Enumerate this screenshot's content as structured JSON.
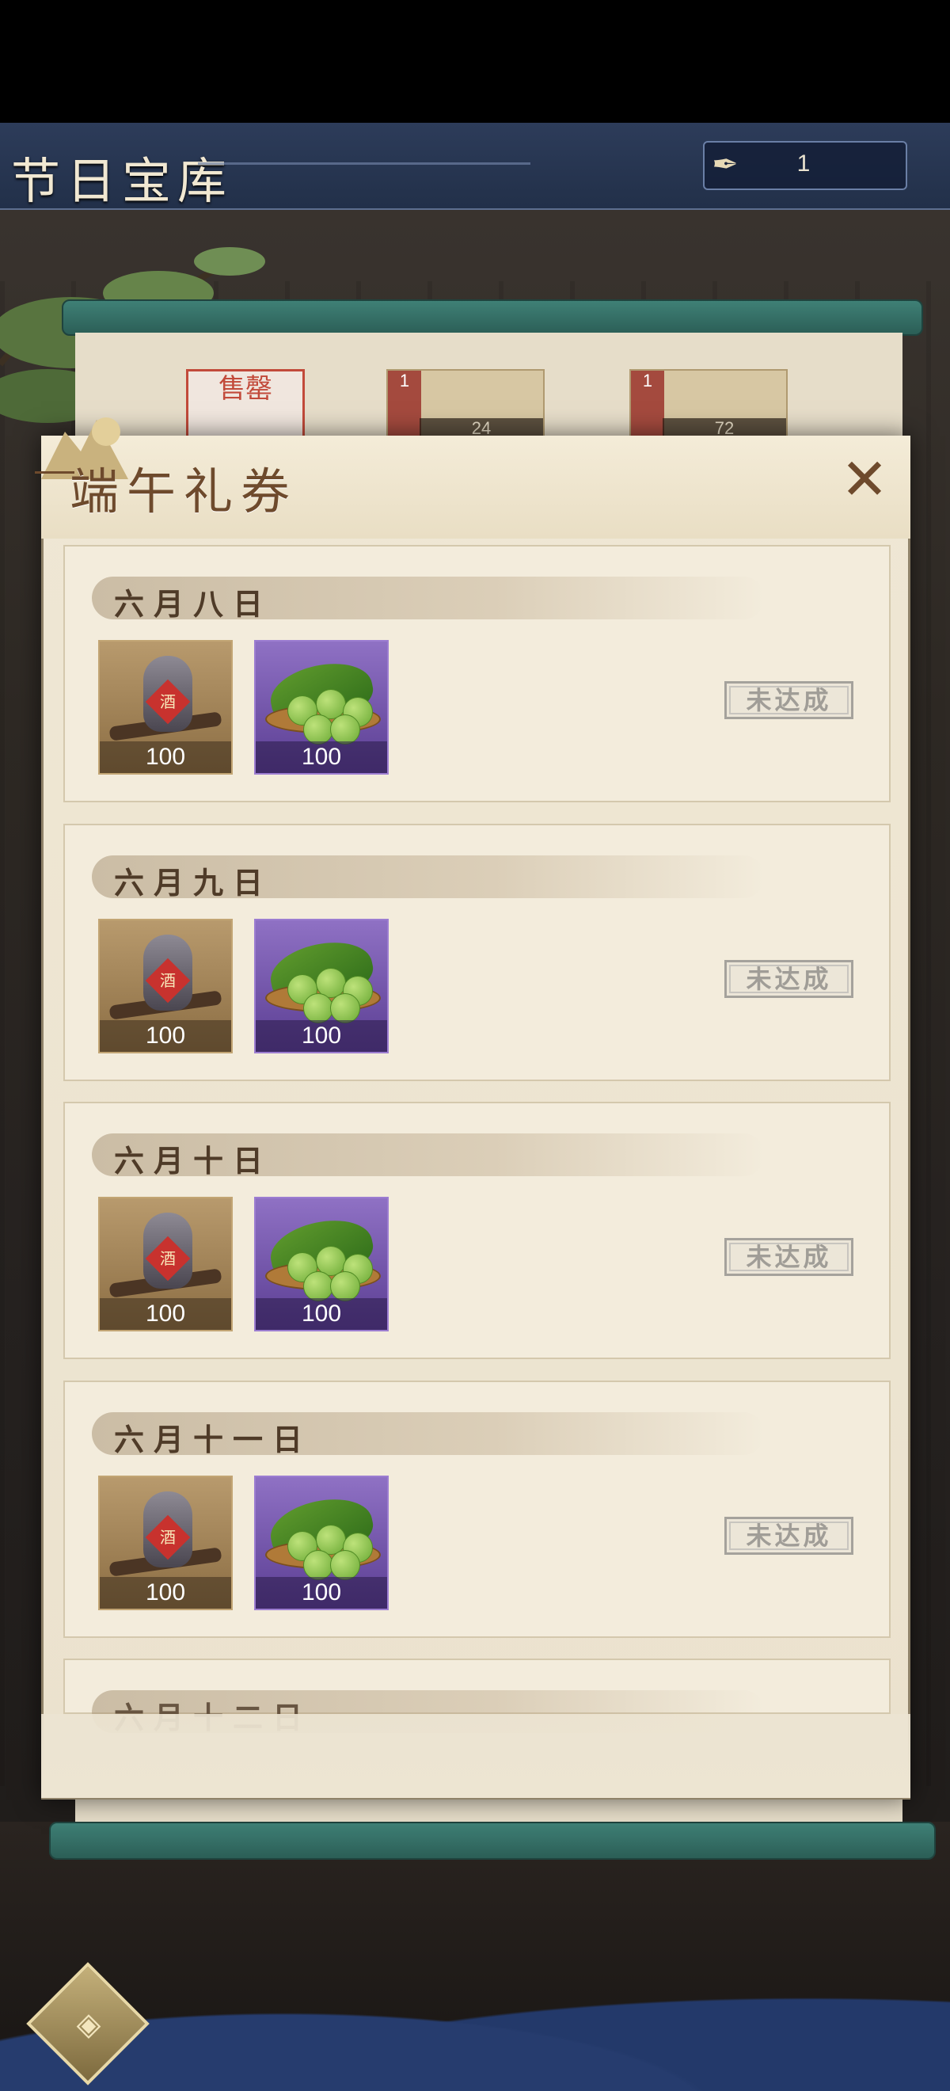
{
  "header": {
    "title": "节日宝库",
    "currency_icon": "feather-quill-icon",
    "currency_value": "1"
  },
  "shop": {
    "sold_sign": "售罄",
    "items": [
      {
        "tag": "1",
        "count": "24"
      },
      {
        "tag": "1",
        "count": "72"
      }
    ]
  },
  "modal": {
    "title": "端午礼券",
    "close_label": "✕",
    "days": [
      {
        "label": "六月八日",
        "rewards": [
          {
            "name": "wine",
            "label": "酒",
            "qty": "100"
          },
          {
            "name": "zongzi",
            "qty": "100"
          }
        ],
        "status": "未达成"
      },
      {
        "label": "六月九日",
        "rewards": [
          {
            "name": "wine",
            "label": "酒",
            "qty": "100"
          },
          {
            "name": "zongzi",
            "qty": "100"
          }
        ],
        "status": "未达成"
      },
      {
        "label": "六月十日",
        "rewards": [
          {
            "name": "wine",
            "label": "酒",
            "qty": "100"
          },
          {
            "name": "zongzi",
            "qty": "100"
          }
        ],
        "status": "未达成"
      },
      {
        "label": "六月十一日",
        "rewards": [
          {
            "name": "wine",
            "label": "酒",
            "qty": "100"
          },
          {
            "name": "zongzi",
            "qty": "100"
          }
        ],
        "status": "未达成"
      },
      {
        "label": "六月十二日"
      }
    ]
  },
  "colors": {
    "accent": "#6e4a2c",
    "wine_bg": "#b89a6d",
    "zongzi_bg": "#8f71c4",
    "status_gray": "#a09d97"
  }
}
